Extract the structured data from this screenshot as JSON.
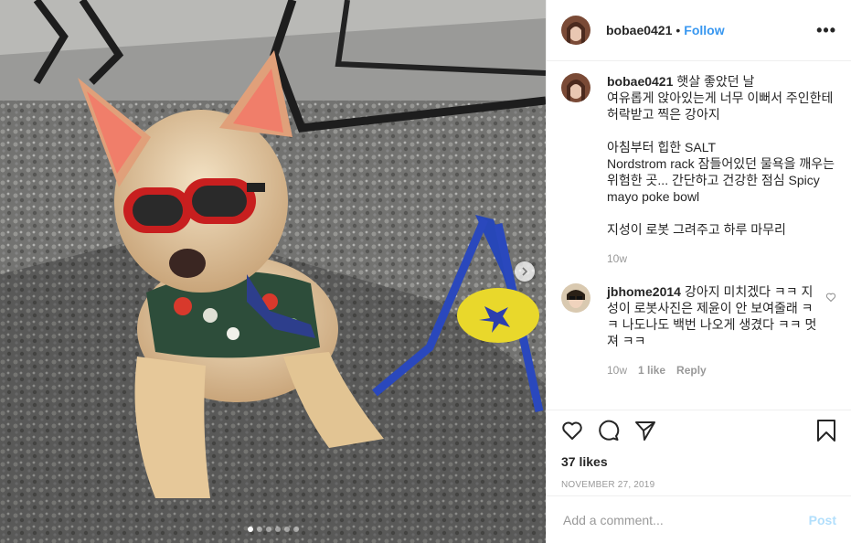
{
  "post": {
    "photo_description_icon": "dog-photo",
    "carousel": {
      "next_icon": "chevron-right-icon",
      "slide_count": 6,
      "active_slide": 1
    }
  },
  "header": {
    "username": "bobae0421",
    "separator": "•",
    "follow_label": "Follow",
    "more_icon": "more-dots-icon",
    "more_label": "•••"
  },
  "caption": {
    "username": "bobae0421",
    "text": "햇살 좋았던 날\n여유롭게 앉아있는게 너무 이뻐서 주인한테 허락받고 찍은 강아지\n\n아침부터 힙한 SALT\nNordstrom rack 잠들어있던 물욕을 깨우는 위험한 곳... 간단하고 건강한 점심 Spicy mayo poke bowl\n\n지성이 로봇 그려주고 하루 마무리",
    "time": "10w"
  },
  "comments": [
    {
      "username": "jbhome2014",
      "text": "강아지 미치겠다 ㅋㅋ 지성이 로봇사진은 제윤이 안 보여줄래 ㅋㅋ 나도나도 백번 나오게 생겼다 ㅋㅋ 멋져 ㅋㅋ",
      "time": "10w",
      "likes": "1 like",
      "reply": "Reply"
    }
  ],
  "actions": {
    "like_icon": "heart-icon",
    "comment_icon": "comment-icon",
    "share_icon": "share-icon",
    "save_icon": "bookmark-icon",
    "likes_text": "37 likes",
    "date": "NOVEMBER 27, 2019"
  },
  "add_comment": {
    "placeholder": "Add a comment...",
    "post_label": "Post"
  },
  "colors": {
    "link": "#3897f0",
    "post_disabled": "#b2dffc",
    "muted": "#999999"
  }
}
